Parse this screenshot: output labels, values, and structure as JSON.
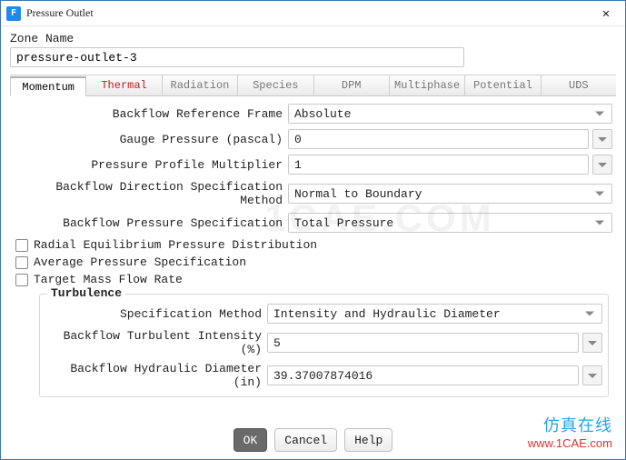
{
  "window": {
    "title": "Pressure Outlet",
    "icon_letter": "F",
    "close_glyph": "✕"
  },
  "zone": {
    "label": "Zone Name",
    "value": "pressure-outlet-3"
  },
  "tabs": [
    "Momentum",
    "Thermal",
    "Radiation",
    "Species",
    "DPM",
    "Multiphase",
    "Potential",
    "UDS"
  ],
  "active_tab": "Momentum",
  "fields": {
    "ref_frame_label": "Backflow Reference Frame",
    "ref_frame_value": "Absolute",
    "gauge_label": "Gauge Pressure (pascal)",
    "gauge_value": "0",
    "ppm_label": "Pressure Profile Multiplier",
    "ppm_value": "1",
    "dir_label": "Backflow Direction Specification Method",
    "dir_value": "Normal to Boundary",
    "bps_label": "Backflow Pressure Specification",
    "bps_value": "Total Pressure"
  },
  "checks": {
    "radial": "Radial Equilibrium Pressure Distribution",
    "avg": "Average Pressure Specification",
    "target": "Target Mass Flow Rate"
  },
  "turbulence": {
    "group_title": "Turbulence",
    "spec_label": "Specification Method",
    "spec_value": "Intensity and Hydraulic Diameter",
    "ti_label": "Backflow Turbulent Intensity (%)",
    "ti_value": "5",
    "hd_label": "Backflow Hydraulic Diameter (in)",
    "hd_value": "39.37007874016"
  },
  "buttons": {
    "ok": "OK",
    "cancel": "Cancel",
    "help": "Help"
  },
  "watermark": {
    "big": "1CAE.COM",
    "line1": "仿真在线",
    "line2": "www.1CAE.com"
  }
}
